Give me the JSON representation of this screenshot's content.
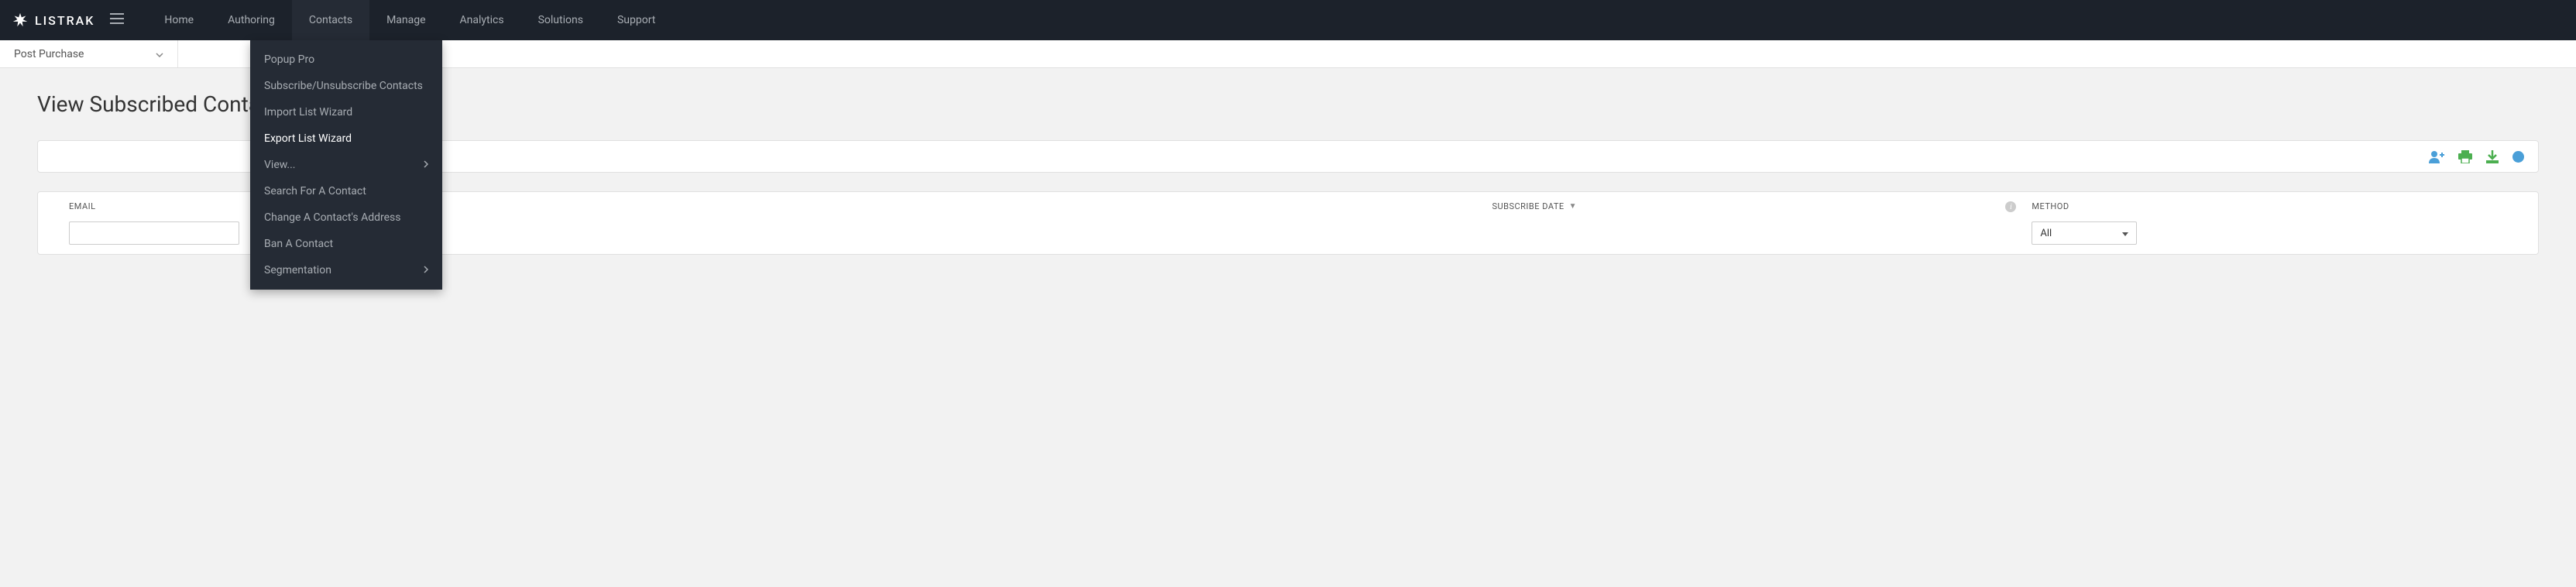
{
  "brand": "LISTRAK",
  "nav": {
    "items": [
      "Home",
      "Authoring",
      "Contacts",
      "Manage",
      "Analytics",
      "Solutions",
      "Support"
    ],
    "active_index": 2
  },
  "list_selector": {
    "value": "Post Purchase"
  },
  "page": {
    "title": "View Subscribed Contacts"
  },
  "contacts_menu": {
    "items": [
      {
        "label": "Popup Pro",
        "submenu": false,
        "highlighted": false
      },
      {
        "label": "Subscribe/Unsubscribe Contacts",
        "submenu": false,
        "highlighted": false
      },
      {
        "label": "Import List Wizard",
        "submenu": false,
        "highlighted": false
      },
      {
        "label": "Export List Wizard",
        "submenu": false,
        "highlighted": true
      },
      {
        "label": "View...",
        "submenu": true,
        "highlighted": false
      },
      {
        "label": "Search For A Contact",
        "submenu": false,
        "highlighted": false
      },
      {
        "label": "Change A Contact's Address",
        "submenu": false,
        "highlighted": false
      },
      {
        "label": "Ban A Contact",
        "submenu": false,
        "highlighted": false
      },
      {
        "label": "Segmentation",
        "submenu": true,
        "highlighted": false
      }
    ]
  },
  "table": {
    "columns": {
      "email": "EMAIL",
      "subscribe_date": "SUBSCRIBE DATE",
      "method": "METHOD"
    },
    "filters": {
      "email_value": "",
      "method_value": "All"
    }
  },
  "toolbar_icons": {
    "add_contact": "add-contact",
    "print": "print",
    "download": "download",
    "info": "info"
  },
  "colors": {
    "nav_bg": "#1c222b",
    "dropdown_bg": "#252b35",
    "icon_blue": "#4a9fd8",
    "icon_green": "#4caf50"
  }
}
